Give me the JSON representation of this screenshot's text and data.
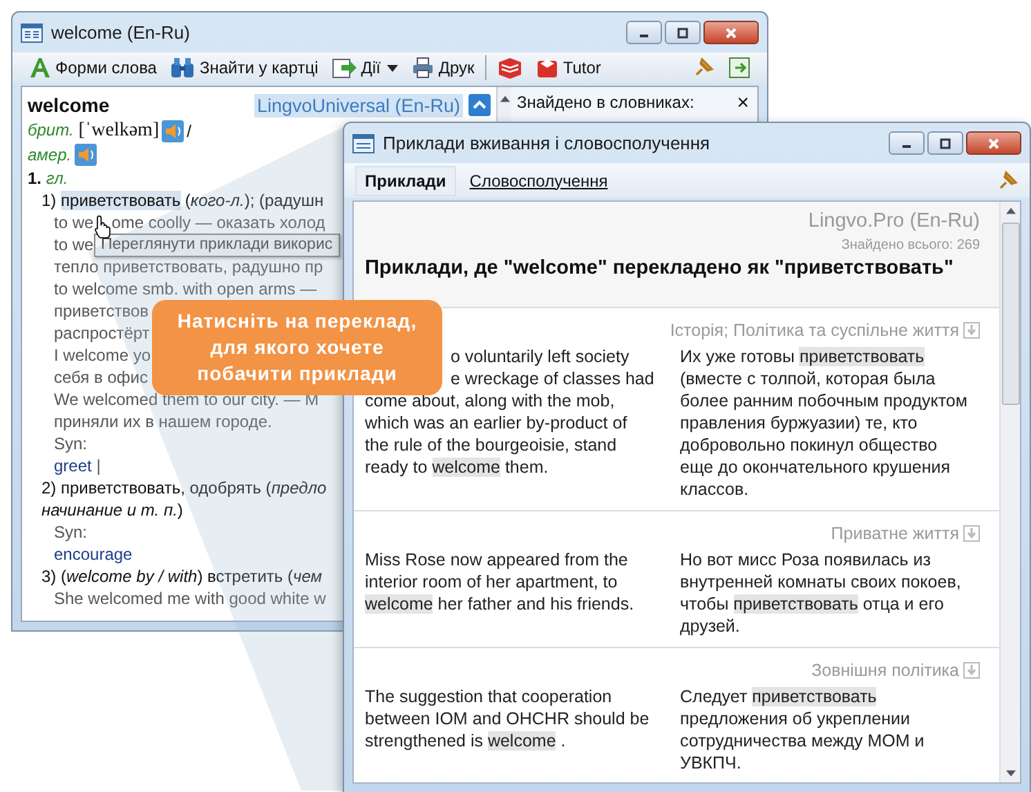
{
  "back_window": {
    "title": "welcome (En-Ru)",
    "toolbar": [
      {
        "kind": "forms",
        "label": "Форми слова"
      },
      {
        "kind": "find",
        "label": "Знайти у картці"
      },
      {
        "kind": "actions",
        "label": "Дії"
      },
      {
        "kind": "print",
        "label": "Друк"
      },
      {
        "kind": "book"
      },
      {
        "kind": "tutor",
        "label": "Tutor"
      }
    ],
    "entry": {
      "headword": "welcome",
      "dictionary": "LingvoUniversal (En-Ru)",
      "lines": [
        {
          "kind": "main",
          "parts": [
            {
              "kind": "label",
              "text": "брит."
            },
            {
              "kind": "phon",
              "text": " [ˈwelkəm] "
            },
            {
              "kind": "sound"
            },
            {
              "kind": "plain",
              "text": " /"
            }
          ]
        },
        {
          "kind": "main",
          "parts": [
            {
              "kind": "label",
              "text": "амер. "
            },
            {
              "kind": "sound"
            }
          ]
        },
        {
          "kind": "main",
          "parts": [
            {
              "kind": "bold",
              "text": "1. "
            },
            {
              "kind": "label",
              "text": "гл."
            }
          ]
        },
        {
          "kind": "sense",
          "parts": [
            {
              "kind": "plain",
              "text": "1) "
            },
            {
              "kind": "hl",
              "text": "приветствовать"
            },
            {
              "kind": "plain",
              "text": " ("
            },
            {
              "kind": "italic",
              "text": "кого-л."
            },
            {
              "kind": "plain",
              "text": "); (радушн"
            }
          ]
        },
        {
          "kind": "example",
          "parts": [
            {
              "kind": "plain",
              "text": "to we"
            },
            {
              "kind": "cursor"
            },
            {
              "kind": "plain",
              "text": "ome coolly — оказать холод"
            }
          ]
        },
        {
          "kind": "example",
          "parts": [
            {
              "kind": "plain",
              "text": "to we"
            }
          ]
        },
        {
          "kind": "example",
          "parts": [
            {
              "kind": "plain",
              "text": "тепло приветствовать, радушно пр"
            }
          ]
        },
        {
          "kind": "example",
          "parts": [
            {
              "kind": "plain",
              "text": "to welcome smb. with open arms —"
            }
          ]
        },
        {
          "kind": "example",
          "parts": [
            {
              "kind": "plain",
              "text": "приветствов"
            }
          ]
        },
        {
          "kind": "example",
          "parts": [
            {
              "kind": "plain",
              "text": "распростёрт"
            }
          ]
        },
        {
          "kind": "example",
          "parts": [
            {
              "kind": "plain",
              "text": "I welcome yo"
            }
          ]
        },
        {
          "kind": "example",
          "parts": [
            {
              "kind": "plain",
              "text": "себя в офис"
            }
          ]
        },
        {
          "kind": "example",
          "parts": [
            {
              "kind": "plain",
              "text": "We welcomed them to our city. — М"
            }
          ]
        },
        {
          "kind": "example",
          "parts": [
            {
              "kind": "plain",
              "text": "приняли их в нашем городе."
            }
          ]
        },
        {
          "kind": "synlabel",
          "parts": [
            {
              "kind": "plain",
              "text": "Syn:"
            }
          ]
        },
        {
          "kind": "syn",
          "parts": [
            {
              "kind": "link",
              "text": "greet"
            },
            {
              "kind": "plain",
              "text": " |"
            }
          ]
        },
        {
          "kind": "sense",
          "parts": [
            {
              "kind": "plain",
              "text": "2) приветствовать, одобрять ("
            },
            {
              "kind": "italic",
              "text": "предло"
            }
          ]
        },
        {
          "kind": "sense",
          "parts": [
            {
              "kind": "italic",
              "text": "начинание и т. п."
            },
            {
              "kind": "plain",
              "text": ")"
            }
          ]
        },
        {
          "kind": "synlabel",
          "parts": [
            {
              "kind": "plain",
              "text": "Syn:"
            }
          ]
        },
        {
          "kind": "syn",
          "parts": [
            {
              "kind": "link",
              "text": "encourage"
            }
          ]
        },
        {
          "kind": "sense",
          "parts": [
            {
              "kind": "plain",
              "text": "3) ("
            },
            {
              "kind": "italic",
              "text": "welcome by / with"
            },
            {
              "kind": "plain",
              "text": ") встретить ("
            },
            {
              "kind": "italic",
              "text": "чем"
            }
          ]
        },
        {
          "kind": "example",
          "parts": [
            {
              "kind": "plain",
              "text": "She welcomed me with good white w"
            }
          ]
        }
      ]
    },
    "tooltip": "Переглянути приклади викорис",
    "side_panel": {
      "title": "Знайдено в словниках:",
      "close": "×"
    }
  },
  "callout": [
    "Натисніть на переклад,",
    "для якого хочете",
    "побачити приклади"
  ],
  "front_window": {
    "title": "Приклади вживання і словосполучення",
    "tabs": [
      {
        "label": "Приклади",
        "selected": true
      },
      {
        "label": "Словосполучення",
        "selected": false
      }
    ],
    "source": "Lingvo.Pro (En-Ru)",
    "found": "Знайдено всього: 269",
    "heading": "Приклади, де \"welcome\" перекладено як \"приветствовать\"",
    "examples": [
      {
        "category": "Історія; Політика та суспільне життя",
        "en": [
          [
            {
              "text": "o voluntarily left society",
              "marked": false
            }
          ],
          [
            {
              "text": "e wreckage of classes had",
              "marked": false
            }
          ],
          [
            {
              "text": "come about, along with the mob,",
              "marked": false
            }
          ],
          [
            {
              "text": "which was an earlier by-product of",
              "marked": false
            }
          ],
          [
            {
              "text": "the rule of the bourgeoisie, stand",
              "marked": false
            }
          ],
          [
            {
              "text": "ready to ",
              "marked": false
            },
            {
              "text": "welcome",
              "marked": true
            },
            {
              "text": " them.",
              "marked": false
            }
          ]
        ],
        "ru": [
          [
            {
              "text": "Их уже готовы ",
              "marked": false
            },
            {
              "text": "приветствовать",
              "marked": true
            }
          ],
          [
            {
              "text": "(вместе с толпой, которая была",
              "marked": false
            }
          ],
          [
            {
              "text": "более ранним побочным продуктом",
              "marked": false
            }
          ],
          [
            {
              "text": "правления буржуазии) те, кто",
              "marked": false
            }
          ],
          [
            {
              "text": "добровольно покинул общество",
              "marked": false
            }
          ],
          [
            {
              "text": "еще до окончательного крушения",
              "marked": false
            }
          ],
          [
            {
              "text": "классов.",
              "marked": false
            }
          ]
        ]
      },
      {
        "category": "Приватне життя",
        "en": [
          [
            {
              "text": "Miss Rose now appeared from the",
              "marked": false
            }
          ],
          [
            {
              "text": "interior room of her apartment, to",
              "marked": false
            }
          ],
          [
            {
              "text": "welcome",
              "marked": true
            },
            {
              "text": " her father and his friends.",
              "marked": false
            }
          ]
        ],
        "ru": [
          [
            {
              "text": "Но вот мисс Роза появилась из",
              "marked": false
            }
          ],
          [
            {
              "text": "внутренней комнаты своих покоев,",
              "marked": false
            }
          ],
          [
            {
              "text": "чтобы ",
              "marked": false
            },
            {
              "text": "приветствовать",
              "marked": true
            },
            {
              "text": " отца и его",
              "marked": false
            }
          ],
          [
            {
              "text": "друзей.",
              "marked": false
            }
          ]
        ]
      },
      {
        "category": "Зовнішня політика",
        "en": [
          [
            {
              "text": "The suggestion that cooperation",
              "marked": false
            }
          ],
          [
            {
              "text": "between IOM and OHCHR should be",
              "marked": false
            }
          ],
          [
            {
              "text": "strengthened is ",
              "marked": false
            },
            {
              "text": "welcome",
              "marked": true
            },
            {
              "text": " .",
              "marked": false
            }
          ]
        ],
        "ru": [
          [
            {
              "text": "Следует ",
              "marked": false
            },
            {
              "text": "приветствовать",
              "marked": true
            }
          ],
          [
            {
              "text": "предложения об укреплении",
              "marked": false
            }
          ],
          [
            {
              "text": "сотрудничества между МОМ и",
              "marked": false
            }
          ],
          [
            {
              "text": "УВКПЧ.",
              "marked": false
            }
          ]
        ]
      }
    ]
  }
}
